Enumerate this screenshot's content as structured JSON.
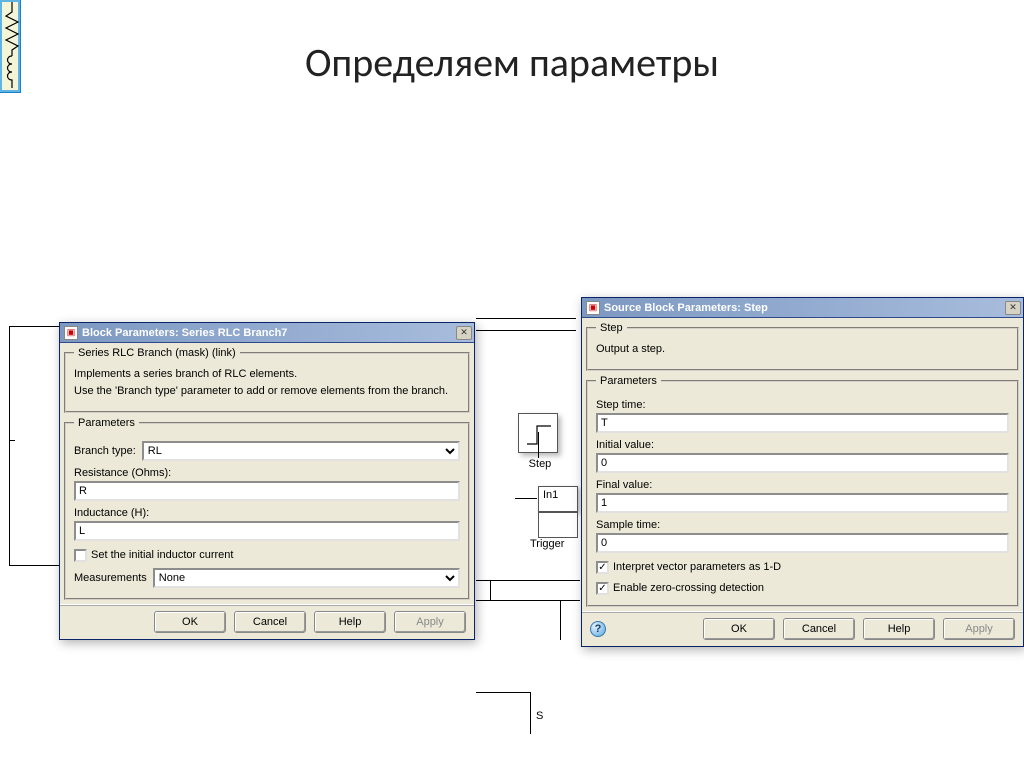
{
  "page": {
    "title": "Определяем параметры"
  },
  "sim_labels": {
    "step": "Step",
    "trigger": "Trigger",
    "s_text": "S",
    "in1": "In1"
  },
  "dialog_left": {
    "title": "Block Parameters: Series RLC Branch7",
    "group_title": "Series RLC Branch (mask) (link)",
    "desc1": "Implements a series branch of RLC elements.",
    "desc2": "Use the 'Branch type' parameter to add or remove elements from the branch.",
    "params_title": "Parameters",
    "branch_type_label": "Branch type:",
    "branch_type_value": "RL",
    "resistance_label": "Resistance (Ohms):",
    "resistance_value": "R",
    "inductance_label": "Inductance (H):",
    "inductance_value": "L",
    "initial_inductor_label": "Set the initial inductor current",
    "measurements_label": "Measurements",
    "measurements_value": "None",
    "buttons": {
      "ok": "OK",
      "cancel": "Cancel",
      "help": "Help",
      "apply": "Apply"
    }
  },
  "dialog_right": {
    "title": "Source Block Parameters: Step",
    "group_title": "Step",
    "desc": "Output a step.",
    "params_title": "Parameters",
    "step_time_label": "Step time:",
    "step_time_value": "T",
    "initial_value_label": "Initial value:",
    "initial_value_value": "0",
    "final_value_label": "Final value:",
    "final_value_value": "1",
    "sample_time_label": "Sample time:",
    "sample_time_value": "0",
    "interpret_label": "Interpret vector parameters as 1-D",
    "zero_crossing_label": "Enable zero-crossing detection",
    "buttons": {
      "ok": "OK",
      "cancel": "Cancel",
      "help": "Help",
      "apply": "Apply"
    }
  }
}
